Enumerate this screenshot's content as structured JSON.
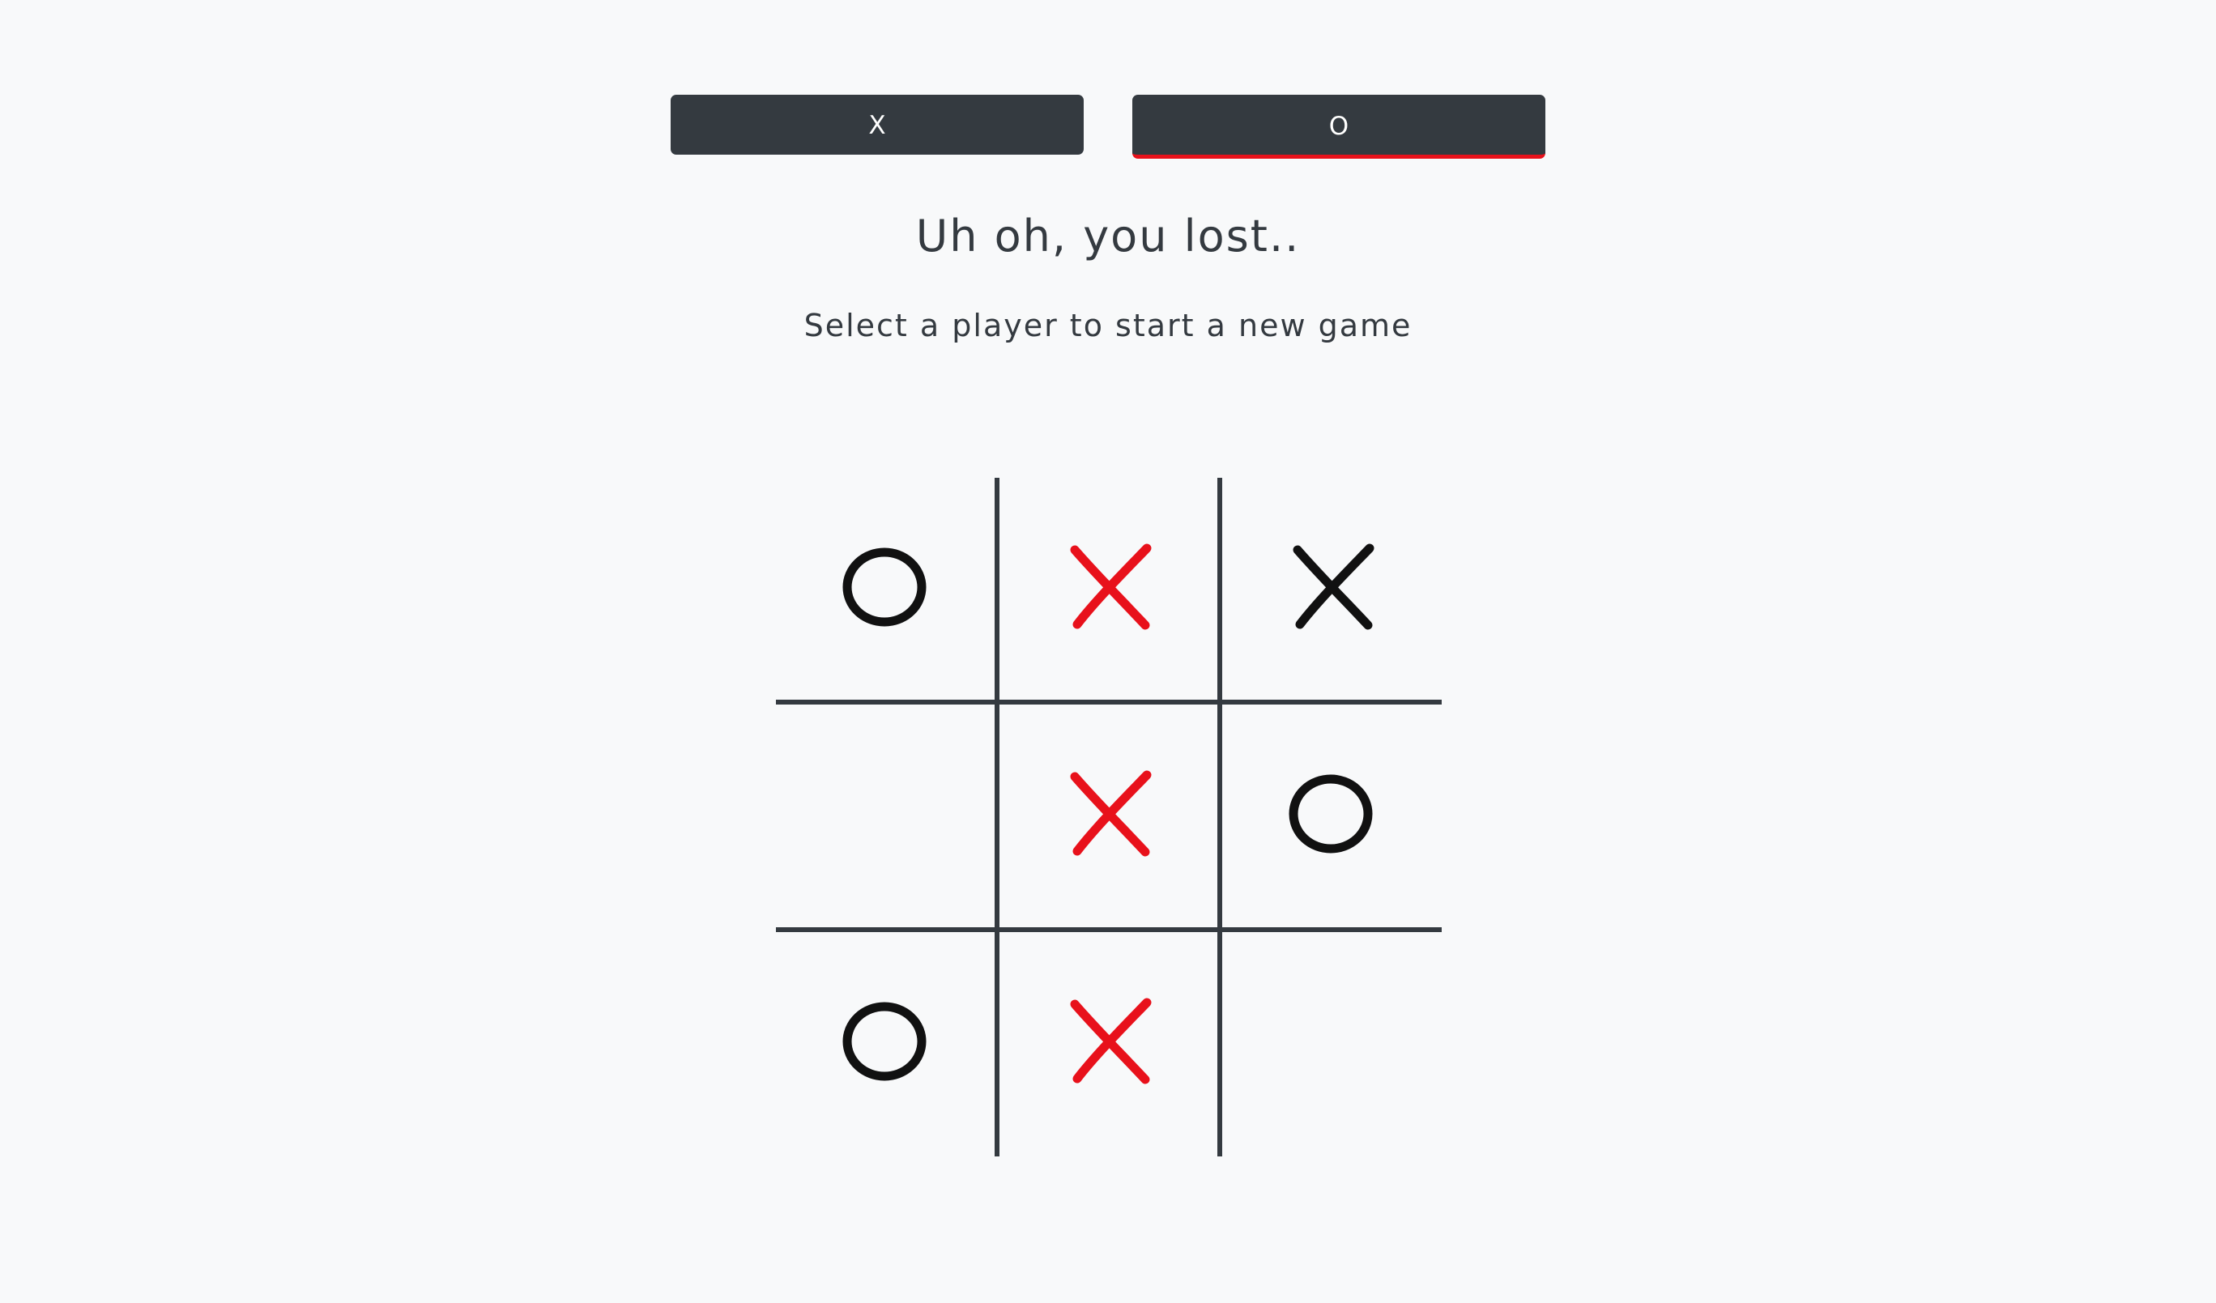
{
  "players": {
    "x_label": "X",
    "o_label": "O",
    "active_player": "O"
  },
  "status": {
    "headline": "Uh oh, you lost..",
    "instruction": "Select a player to start a new game"
  },
  "board": {
    "cells": [
      "O",
      "X",
      "X",
      "",
      "X",
      "O",
      "O",
      "X",
      ""
    ],
    "cell_colors": [
      "dark",
      "red",
      "dark",
      "",
      "red",
      "dark",
      "dark",
      "red",
      ""
    ]
  },
  "colors": {
    "background": "#f8f9fa",
    "button": "#343a40",
    "button_text": "#ffffff",
    "accent_red": "#e8111b",
    "mark_dark": "#111111",
    "grid": "#343a40"
  }
}
